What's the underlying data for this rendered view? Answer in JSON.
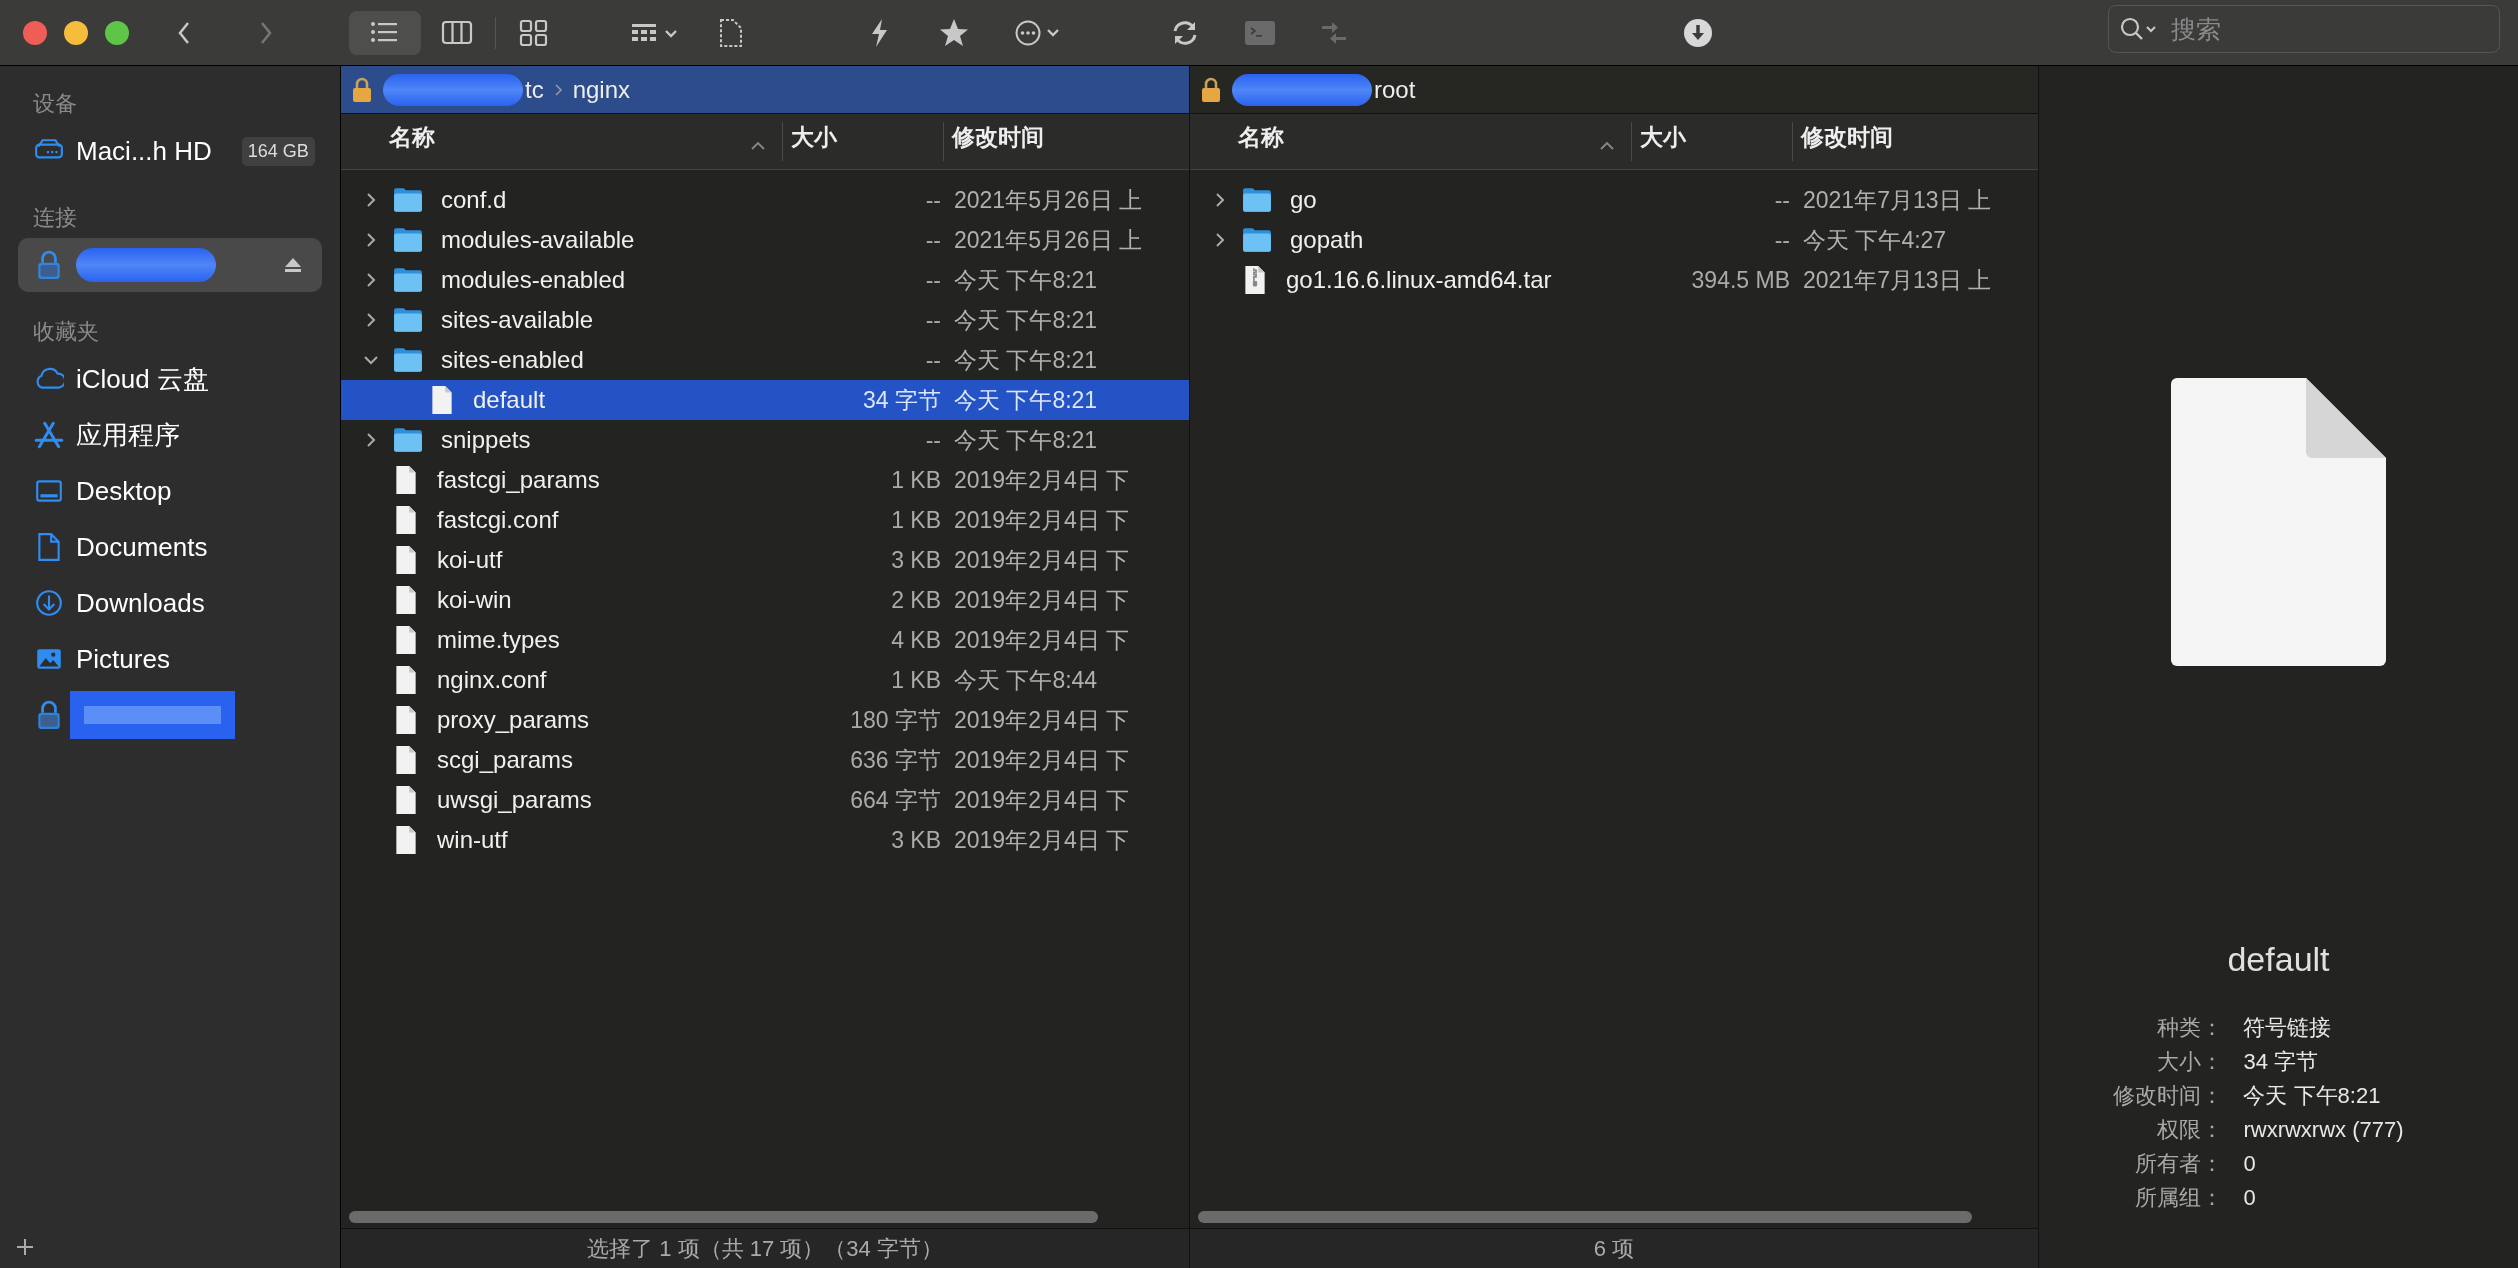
{
  "toolbar": {
    "view_modes": [
      {
        "kind": "list",
        "selected": true
      },
      {
        "kind": "columns",
        "selected": false
      },
      {
        "kind": "grid",
        "selected": false
      }
    ],
    "search": {
      "placeholder": "搜索"
    }
  },
  "sidebar": {
    "sections": [
      {
        "title": "设备",
        "items": [
          {
            "kind": "disk",
            "label": "Maci...h HD",
            "badge": "164 GB",
            "selected": false
          }
        ]
      },
      {
        "title": "连接",
        "items": [
          {
            "kind": "server",
            "redacted": true,
            "eject": true,
            "selected": true
          }
        ]
      },
      {
        "title": "收藏夹",
        "items": [
          {
            "kind": "cloud",
            "label": "iCloud 云盘",
            "selected": false
          },
          {
            "kind": "apps",
            "label": "应用程序",
            "selected": false
          },
          {
            "kind": "desktop",
            "label": "Desktop",
            "selected": false
          },
          {
            "kind": "document",
            "label": "Documents",
            "selected": false
          },
          {
            "kind": "download",
            "label": "Downloads",
            "selected": false
          },
          {
            "kind": "pictures",
            "label": "Pictures",
            "selected": false
          },
          {
            "kind": "server",
            "redacted": true,
            "eject": false,
            "selected": false
          }
        ]
      }
    ]
  },
  "panes": [
    {
      "active": true,
      "path": {
        "redacted": true,
        "segments": [
          "tc",
          "nginx"
        ]
      },
      "columns": [
        "名称",
        "大小",
        "修改时间"
      ],
      "rows": [
        {
          "kind": "folder",
          "name": "conf.d",
          "size": "--",
          "modified": "2021年5月26日 上",
          "expanded": false,
          "selected": false
        },
        {
          "kind": "folder",
          "name": "modules-available",
          "size": "--",
          "modified": "2021年5月26日 上",
          "expanded": false,
          "selected": false
        },
        {
          "kind": "folder",
          "name": "modules-enabled",
          "size": "--",
          "modified": "今天 下午8:21",
          "expanded": false,
          "selected": false
        },
        {
          "kind": "folder",
          "name": "sites-available",
          "size": "--",
          "modified": "今天 下午8:21",
          "expanded": false,
          "selected": false
        },
        {
          "kind": "folder",
          "name": "sites-enabled",
          "size": "--",
          "modified": "今天 下午8:21",
          "expanded": true,
          "selected": false,
          "children": [
            {
              "kind": "file",
              "name": "default",
              "size": "34 字节",
              "modified": "今天 下午8:21",
              "selected": true
            }
          ]
        },
        {
          "kind": "folder",
          "name": "snippets",
          "size": "--",
          "modified": "今天 下午8:21",
          "expanded": false,
          "selected": false
        },
        {
          "kind": "file",
          "name": "fastcgi_params",
          "size": "1 KB",
          "modified": "2019年2月4日 下",
          "selected": false
        },
        {
          "kind": "file",
          "name": "fastcgi.conf",
          "size": "1 KB",
          "modified": "2019年2月4日 下",
          "selected": false
        },
        {
          "kind": "file",
          "name": "koi-utf",
          "size": "3 KB",
          "modified": "2019年2月4日 下",
          "selected": false
        },
        {
          "kind": "file",
          "name": "koi-win",
          "size": "2 KB",
          "modified": "2019年2月4日 下",
          "selected": false
        },
        {
          "kind": "file",
          "name": "mime.types",
          "size": "4 KB",
          "modified": "2019年2月4日 下",
          "selected": false
        },
        {
          "kind": "file",
          "name": "nginx.conf",
          "size": "1 KB",
          "modified": "今天 下午8:44",
          "selected": false
        },
        {
          "kind": "file",
          "name": "proxy_params",
          "size": "180 字节",
          "modified": "2019年2月4日 下",
          "selected": false
        },
        {
          "kind": "file",
          "name": "scgi_params",
          "size": "636 字节",
          "modified": "2019年2月4日 下",
          "selected": false
        },
        {
          "kind": "file",
          "name": "uwsgi_params",
          "size": "664 字节",
          "modified": "2019年2月4日 下",
          "selected": false
        },
        {
          "kind": "file",
          "name": "win-utf",
          "size": "3 KB",
          "modified": "2019年2月4日 下",
          "selected": false
        }
      ],
      "status": "选择了 1 项（共 17 项）（34 字节）"
    },
    {
      "active": false,
      "path": {
        "redacted": true,
        "segments": [
          "root"
        ]
      },
      "columns": [
        "名称",
        "大小",
        "修改时间"
      ],
      "rows": [
        {
          "kind": "folder",
          "name": "go",
          "size": "--",
          "modified": "2021年7月13日 上",
          "expanded": false,
          "selected": false
        },
        {
          "kind": "folder",
          "name": "gopath",
          "size": "--",
          "modified": "今天 下午4:27",
          "expanded": false,
          "selected": false
        },
        {
          "kind": "archive",
          "name": "go1.16.6.linux-amd64.tar",
          "size": "394.5 MB",
          "modified": "2021年7月13日 上",
          "selected": false
        }
      ],
      "status": "6 项"
    }
  ],
  "preview": {
    "title": "default",
    "properties": [
      {
        "label": "种类：",
        "value": "符号链接"
      },
      {
        "label": "大小：",
        "value": "34 字节"
      },
      {
        "label": "修改时间：",
        "value": "今天 下午8:21"
      },
      {
        "label": "权限：",
        "value": "rwxrwxrwx (777)"
      },
      {
        "label": "所有者：",
        "value": "0"
      },
      {
        "label": "所属组：",
        "value": "0"
      }
    ]
  }
}
